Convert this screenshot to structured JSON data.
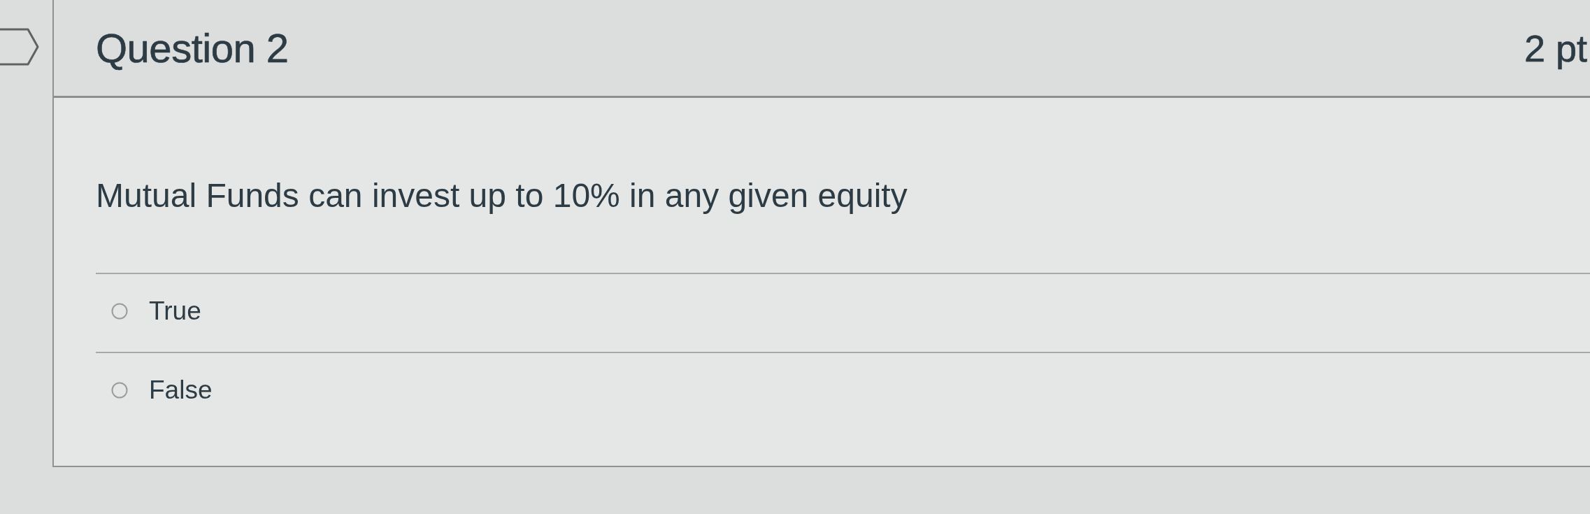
{
  "question": {
    "title": "Question 2",
    "points": "2 pt",
    "text": "Mutual Funds can invest up to 10% in any given equity"
  },
  "answers": [
    {
      "label": "True",
      "selected": false
    },
    {
      "label": "False",
      "selected": false
    }
  ]
}
